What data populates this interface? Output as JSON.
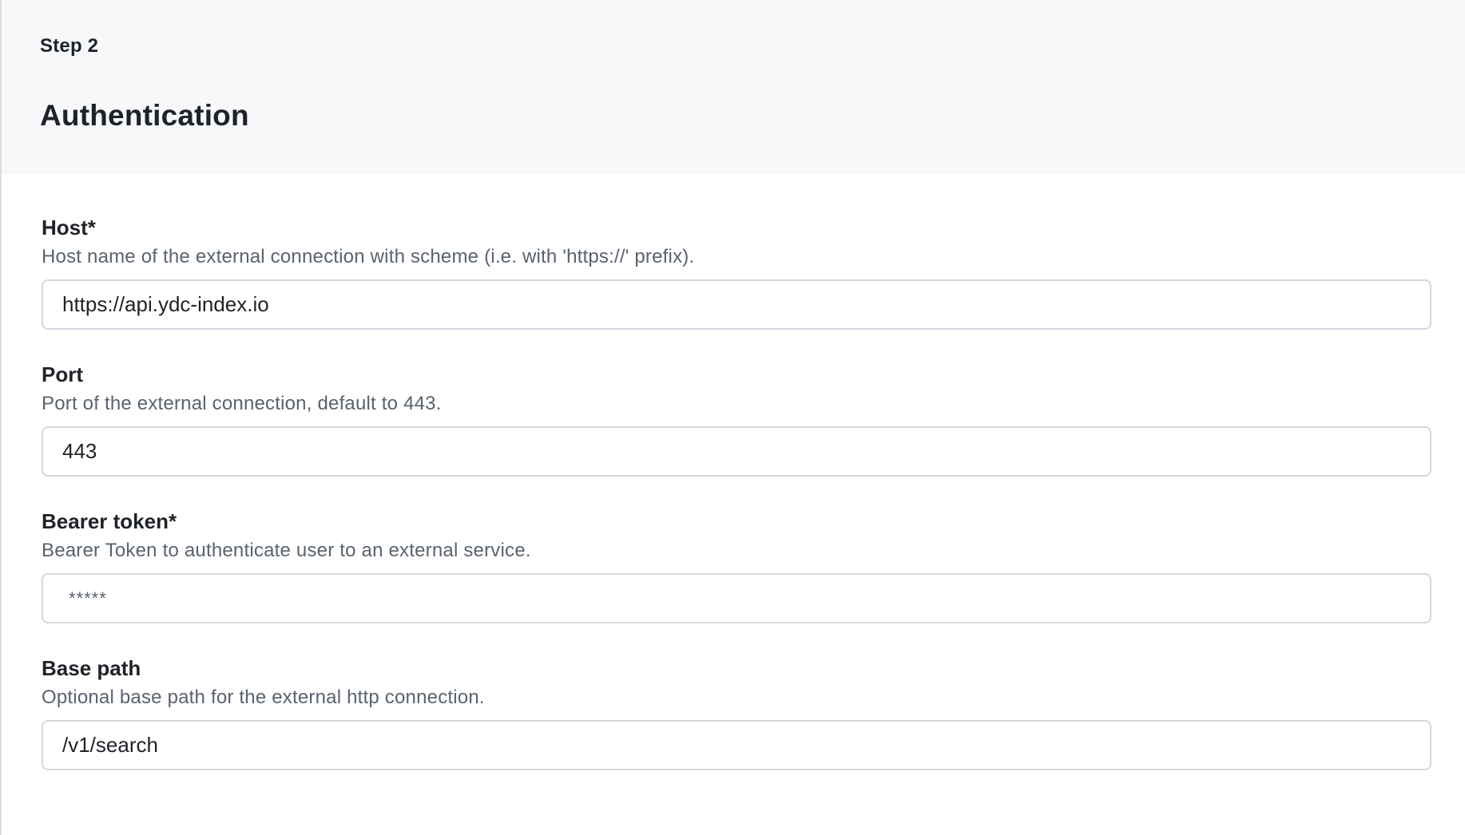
{
  "header": {
    "step": "Step 2",
    "title": "Authentication"
  },
  "fields": [
    {
      "label": "Host*",
      "help": "Host name of the external connection with scheme (i.e. with 'https://' prefix).",
      "value": "https://api.ydc-index.io"
    },
    {
      "label": "Port",
      "help": "Port of the external connection, default to 443.",
      "value": "443"
    },
    {
      "label": "Bearer token*",
      "help": "Bearer Token to authenticate user to an external service.",
      "value": "*****"
    },
    {
      "label": "Base path",
      "help": "Optional base path for the external http connection.",
      "value": "/v1/search"
    }
  ]
}
